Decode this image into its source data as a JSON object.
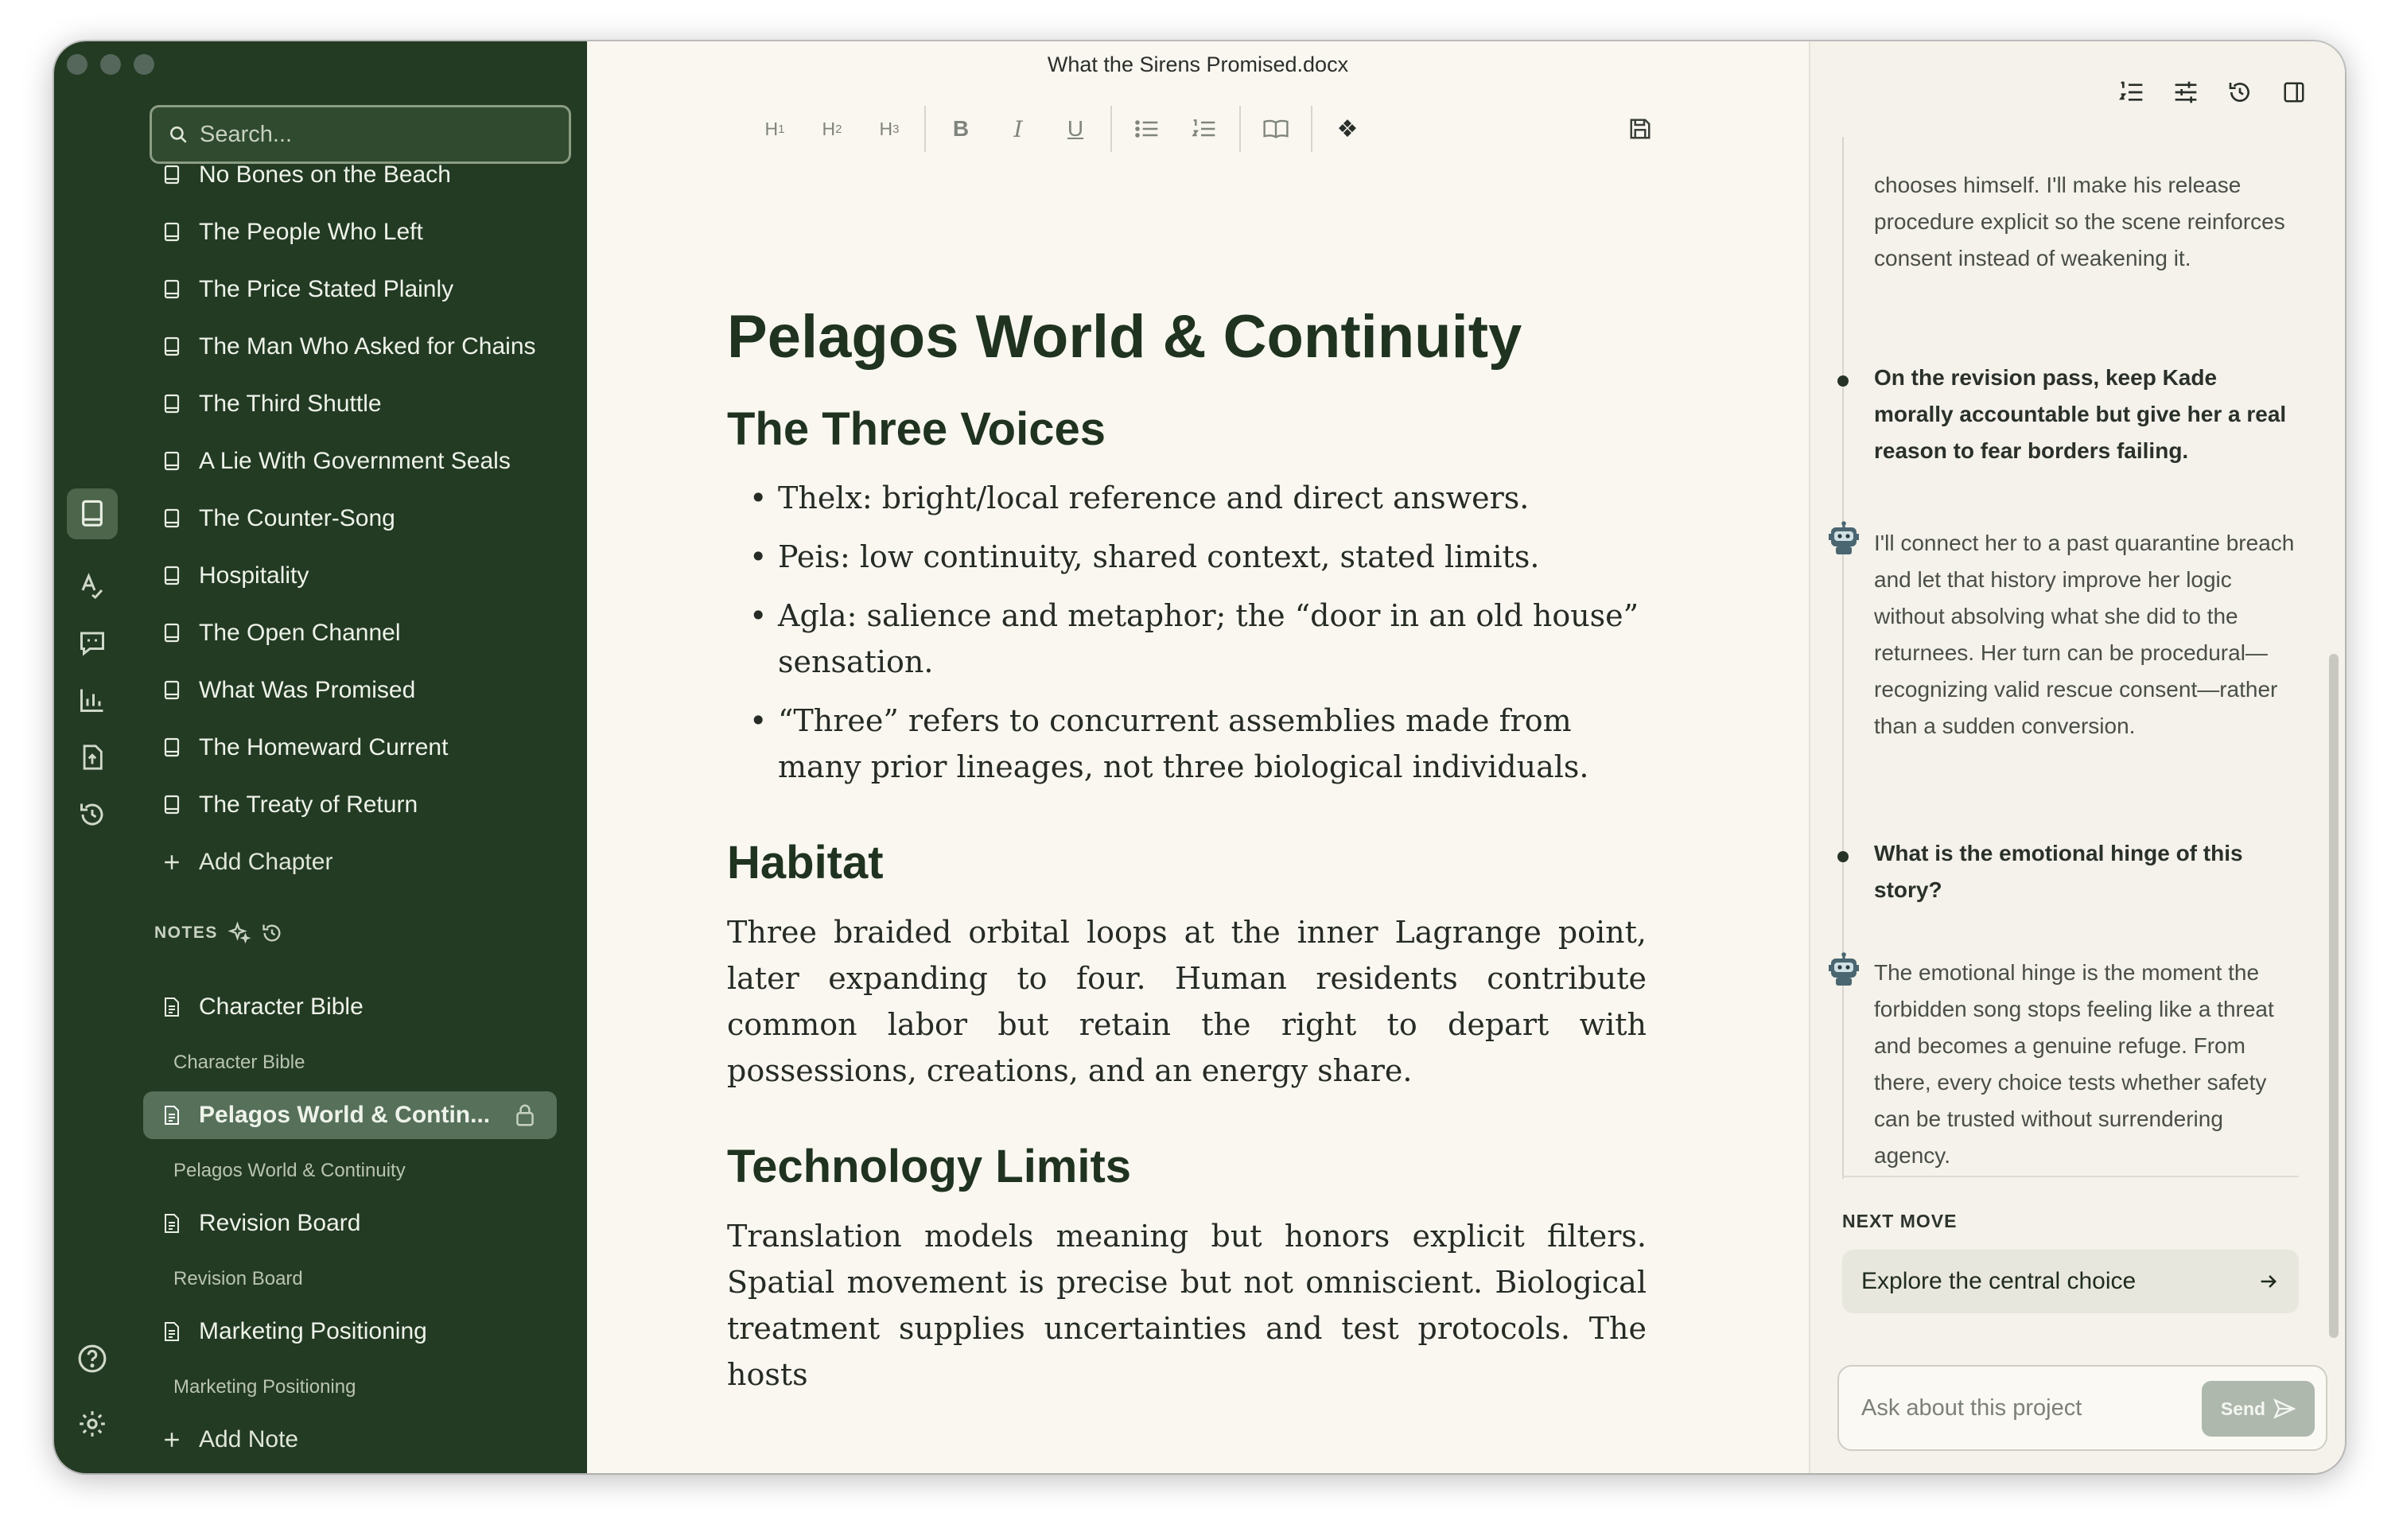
{
  "window": {
    "title": "What the Sirens Promised.docx"
  },
  "sidebar": {
    "search_placeholder": "Search...",
    "chapters": [
      "No Bones on the Beach",
      "The People Who Left",
      "The Price Stated Plainly",
      "The Man Who Asked for Chains",
      "The Third Shuttle",
      "A Lie With Government Seals",
      "The Counter-Song",
      "Hospitality",
      "The Open Channel",
      "What Was Promised",
      "The Homeward Current",
      "The Treaty of Return"
    ],
    "add_chapter_label": "Add Chapter",
    "notes_header": "NOTES",
    "notes": [
      {
        "title": "Character Bible",
        "subtitle": "Character Bible"
      },
      {
        "title": "Pelagos World & Contin...",
        "subtitle": "Pelagos World & Continuity",
        "active": true
      },
      {
        "title": "Revision Board",
        "subtitle": "Revision Board"
      },
      {
        "title": "Marketing Positioning",
        "subtitle": "Marketing Positioning"
      }
    ],
    "add_note_label": "Add Note",
    "rail_icons": [
      "book-icon",
      "spellcheck-icon",
      "comment-icon",
      "chart-icon",
      "export-icon",
      "history-icon",
      "help-icon",
      "gear-icon"
    ]
  },
  "toolbar": {
    "h1": "H",
    "h1_sub": "1",
    "h2": "H",
    "h2_sub": "2",
    "h3": "H",
    "h3_sub": "3",
    "bold": "B",
    "italic": "I",
    "underline": "U",
    "ornament": "❖"
  },
  "document": {
    "title": "Pelagos World & Continuity",
    "section1": {
      "heading": "The Three Voices",
      "bullets": [
        "Thelx: bright/local reference and direct answers.",
        "Peis: low continuity, shared context, stated limits.",
        "Agla: salience and metaphor; the “door in an old house” sensation.",
        "“Three” refers to concurrent assemblies made from many prior lineages, not three biological individuals."
      ]
    },
    "section2": {
      "heading": "Habitat",
      "body": "Three braided orbital loops at the inner Lagrange point, later expanding to four. Human residents contribute common labor but retain the right to depart with possessions, creations, and an energy share."
    },
    "section3": {
      "heading": "Technology Limits",
      "body": "Translation models meaning but honors explicit filters. Spatial movement is precise but not omniscient. Biological treatment supplies uncertainties and test protocols. The hosts"
    }
  },
  "assistant": {
    "messages": [
      {
        "role": "assistant",
        "text": "chooses himself. I'll make his release procedure explicit so the scene reinforces consent instead of weakening it."
      },
      {
        "role": "user",
        "text": "On the revision pass, keep Kade morally accountable but give her a real reason to fear borders failing."
      },
      {
        "role": "assistant",
        "text": "I'll connect her to a past quarantine breach and let that history improve her logic without absolving what she did to the returnees. Her turn can be procedural—recognizing valid rescue consent—rather than a sudden conversion."
      },
      {
        "role": "user",
        "text": "What is the emotional hinge of this story?"
      },
      {
        "role": "assistant",
        "text": "The emotional hinge is the moment the forbidden song stops feeling like a threat and becomes a genuine refuge. From there, every choice tests whether safety can be trusted without surrendering agency."
      }
    ],
    "next_move_label": "NEXT MOVE",
    "next_move_action": "Explore the central choice",
    "ask_placeholder": "Ask about this project",
    "send_label": "Send"
  }
}
